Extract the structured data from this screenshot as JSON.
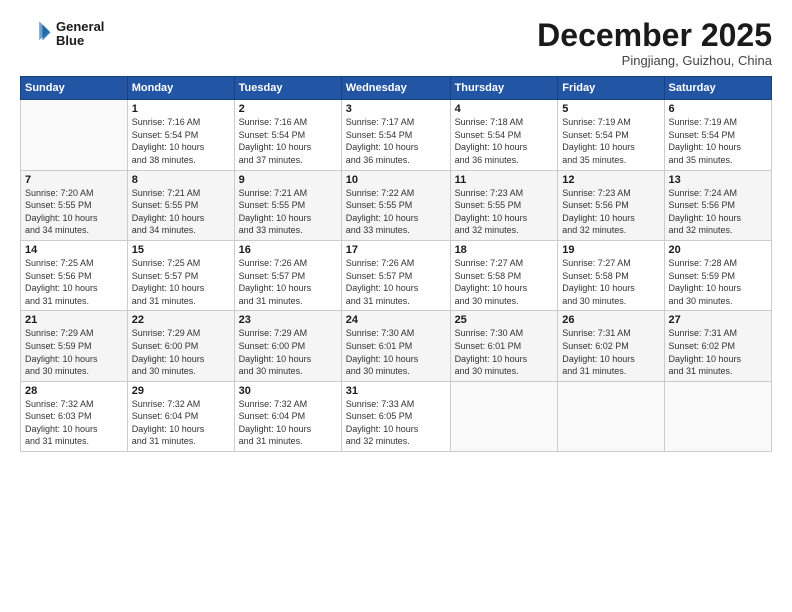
{
  "logo": {
    "line1": "General",
    "line2": "Blue"
  },
  "title": "December 2025",
  "subtitle": "Pingjiang, Guizhou, China",
  "days_header": [
    "Sunday",
    "Monday",
    "Tuesday",
    "Wednesday",
    "Thursday",
    "Friday",
    "Saturday"
  ],
  "weeks": [
    [
      {
        "num": "",
        "info": ""
      },
      {
        "num": "1",
        "info": "Sunrise: 7:16 AM\nSunset: 5:54 PM\nDaylight: 10 hours\nand 38 minutes."
      },
      {
        "num": "2",
        "info": "Sunrise: 7:16 AM\nSunset: 5:54 PM\nDaylight: 10 hours\nand 37 minutes."
      },
      {
        "num": "3",
        "info": "Sunrise: 7:17 AM\nSunset: 5:54 PM\nDaylight: 10 hours\nand 36 minutes."
      },
      {
        "num": "4",
        "info": "Sunrise: 7:18 AM\nSunset: 5:54 PM\nDaylight: 10 hours\nand 36 minutes."
      },
      {
        "num": "5",
        "info": "Sunrise: 7:19 AM\nSunset: 5:54 PM\nDaylight: 10 hours\nand 35 minutes."
      },
      {
        "num": "6",
        "info": "Sunrise: 7:19 AM\nSunset: 5:54 PM\nDaylight: 10 hours\nand 35 minutes."
      }
    ],
    [
      {
        "num": "7",
        "info": "Sunrise: 7:20 AM\nSunset: 5:55 PM\nDaylight: 10 hours\nand 34 minutes."
      },
      {
        "num": "8",
        "info": "Sunrise: 7:21 AM\nSunset: 5:55 PM\nDaylight: 10 hours\nand 34 minutes."
      },
      {
        "num": "9",
        "info": "Sunrise: 7:21 AM\nSunset: 5:55 PM\nDaylight: 10 hours\nand 33 minutes."
      },
      {
        "num": "10",
        "info": "Sunrise: 7:22 AM\nSunset: 5:55 PM\nDaylight: 10 hours\nand 33 minutes."
      },
      {
        "num": "11",
        "info": "Sunrise: 7:23 AM\nSunset: 5:55 PM\nDaylight: 10 hours\nand 32 minutes."
      },
      {
        "num": "12",
        "info": "Sunrise: 7:23 AM\nSunset: 5:56 PM\nDaylight: 10 hours\nand 32 minutes."
      },
      {
        "num": "13",
        "info": "Sunrise: 7:24 AM\nSunset: 5:56 PM\nDaylight: 10 hours\nand 32 minutes."
      }
    ],
    [
      {
        "num": "14",
        "info": "Sunrise: 7:25 AM\nSunset: 5:56 PM\nDaylight: 10 hours\nand 31 minutes."
      },
      {
        "num": "15",
        "info": "Sunrise: 7:25 AM\nSunset: 5:57 PM\nDaylight: 10 hours\nand 31 minutes."
      },
      {
        "num": "16",
        "info": "Sunrise: 7:26 AM\nSunset: 5:57 PM\nDaylight: 10 hours\nand 31 minutes."
      },
      {
        "num": "17",
        "info": "Sunrise: 7:26 AM\nSunset: 5:57 PM\nDaylight: 10 hours\nand 31 minutes."
      },
      {
        "num": "18",
        "info": "Sunrise: 7:27 AM\nSunset: 5:58 PM\nDaylight: 10 hours\nand 30 minutes."
      },
      {
        "num": "19",
        "info": "Sunrise: 7:27 AM\nSunset: 5:58 PM\nDaylight: 10 hours\nand 30 minutes."
      },
      {
        "num": "20",
        "info": "Sunrise: 7:28 AM\nSunset: 5:59 PM\nDaylight: 10 hours\nand 30 minutes."
      }
    ],
    [
      {
        "num": "21",
        "info": "Sunrise: 7:29 AM\nSunset: 5:59 PM\nDaylight: 10 hours\nand 30 minutes."
      },
      {
        "num": "22",
        "info": "Sunrise: 7:29 AM\nSunset: 6:00 PM\nDaylight: 10 hours\nand 30 minutes."
      },
      {
        "num": "23",
        "info": "Sunrise: 7:29 AM\nSunset: 6:00 PM\nDaylight: 10 hours\nand 30 minutes."
      },
      {
        "num": "24",
        "info": "Sunrise: 7:30 AM\nSunset: 6:01 PM\nDaylight: 10 hours\nand 30 minutes."
      },
      {
        "num": "25",
        "info": "Sunrise: 7:30 AM\nSunset: 6:01 PM\nDaylight: 10 hours\nand 30 minutes."
      },
      {
        "num": "26",
        "info": "Sunrise: 7:31 AM\nSunset: 6:02 PM\nDaylight: 10 hours\nand 31 minutes."
      },
      {
        "num": "27",
        "info": "Sunrise: 7:31 AM\nSunset: 6:02 PM\nDaylight: 10 hours\nand 31 minutes."
      }
    ],
    [
      {
        "num": "28",
        "info": "Sunrise: 7:32 AM\nSunset: 6:03 PM\nDaylight: 10 hours\nand 31 minutes."
      },
      {
        "num": "29",
        "info": "Sunrise: 7:32 AM\nSunset: 6:04 PM\nDaylight: 10 hours\nand 31 minutes."
      },
      {
        "num": "30",
        "info": "Sunrise: 7:32 AM\nSunset: 6:04 PM\nDaylight: 10 hours\nand 31 minutes."
      },
      {
        "num": "31",
        "info": "Sunrise: 7:33 AM\nSunset: 6:05 PM\nDaylight: 10 hours\nand 32 minutes."
      },
      {
        "num": "",
        "info": ""
      },
      {
        "num": "",
        "info": ""
      },
      {
        "num": "",
        "info": ""
      }
    ]
  ]
}
